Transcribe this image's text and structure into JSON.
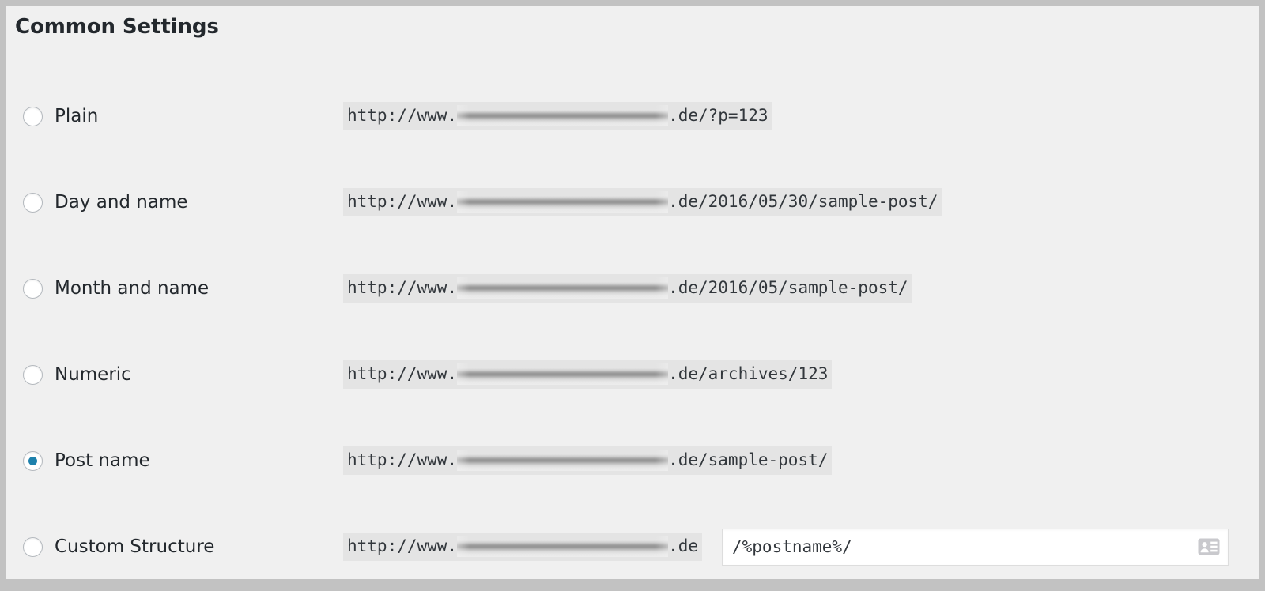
{
  "panel": {
    "title": "Common Settings",
    "accent_color": "#1e81ac",
    "background_color": "#f0f0f0",
    "frame_color": "#c2c2c2",
    "code_background_color": "#e4e4e4"
  },
  "options": [
    {
      "id": "plain",
      "label": "Plain",
      "selected": false,
      "url_prefix": "http://www.",
      "url_domain_redacted": true,
      "url_suffix": ".de/?p=123"
    },
    {
      "id": "day-and-name",
      "label": "Day and name",
      "selected": false,
      "url_prefix": "http://www.",
      "url_domain_redacted": true,
      "url_suffix": ".de/2016/05/30/sample-post/"
    },
    {
      "id": "month-and-name",
      "label": "Month and name",
      "selected": false,
      "url_prefix": "http://www.",
      "url_domain_redacted": true,
      "url_suffix": ".de/2016/05/sample-post/"
    },
    {
      "id": "numeric",
      "label": "Numeric",
      "selected": false,
      "url_prefix": "http://www.",
      "url_domain_redacted": true,
      "url_suffix": ".de/archives/123"
    },
    {
      "id": "post-name",
      "label": "Post name",
      "selected": true,
      "url_prefix": "http://www.",
      "url_domain_redacted": true,
      "url_suffix": ".de/sample-post/"
    },
    {
      "id": "custom-structure",
      "label": "Custom Structure",
      "selected": false,
      "url_prefix": "http://www.",
      "url_domain_redacted": true,
      "url_suffix": ".de"
    }
  ],
  "custom_structure": {
    "value": "/%postname%/",
    "placeholder": "/%postname%/",
    "icon": "contact-card-autofill-icon"
  }
}
